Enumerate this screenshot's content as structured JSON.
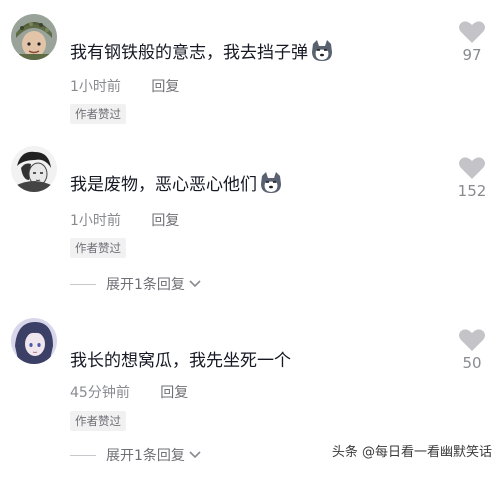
{
  "comments": [
    {
      "text": "我有钢铁般的意志，我去挡子弹",
      "time": "1小时前",
      "reply": "回复",
      "badge": "作者赞过",
      "likes": "97",
      "emoji": "husky-emoji"
    },
    {
      "text": "我是废物，恶心恶心他们",
      "time": "1小时前",
      "reply": "回复",
      "badge": "作者赞过",
      "likes": "152",
      "emoji": "husky-emoji",
      "expand": "展开1条回复"
    },
    {
      "text": "我长的想窝瓜，我先坐死一个",
      "time": "45分钟前",
      "reply": "回复",
      "badge": "作者赞过",
      "likes": "50",
      "expand": "展开1条回复"
    }
  ],
  "watermark": "头条 @每日看一看幽默笑话",
  "colors": {
    "heart": "#c4c4c8",
    "meta": "#8a8b91",
    "badge_bg": "#f1f1f2"
  }
}
